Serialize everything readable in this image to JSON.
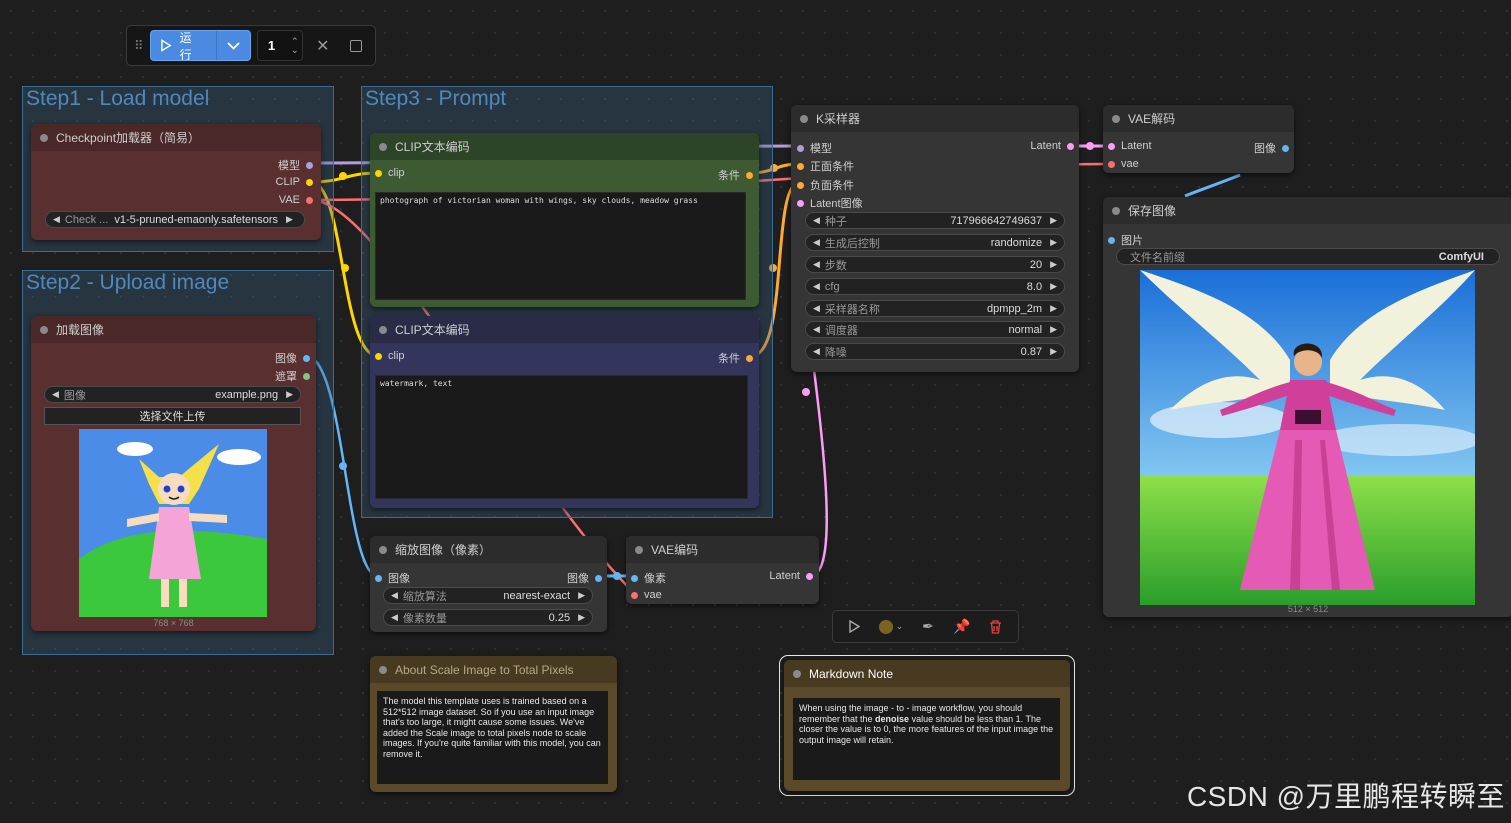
{
  "toolbar": {
    "grip_icon": "drag-handle-icon",
    "run_label": "运行",
    "batch_count": "1",
    "accent": "#4a8ae0"
  },
  "groups": {
    "step1": "Step1 - Load model",
    "step2": "Step2 - Upload image",
    "step3": "Step3 - Prompt"
  },
  "checkpoint": {
    "title": "Checkpoint加载器（简易）",
    "out_model": "模型",
    "out_clip": "CLIP",
    "out_vae": "VAE",
    "ckpt_label": "Check ...",
    "ckpt_value": "v1-5-pruned-emaonly.safetensors"
  },
  "load_image": {
    "title": "加载图像",
    "out_image": "图像",
    "out_mask": "遮罩",
    "image_label": "图像",
    "image_value": "example.png",
    "upload_label": "选择文件上传",
    "size_caption": "768 × 768"
  },
  "clip_pos": {
    "title": "CLIP文本编码",
    "in_clip": "clip",
    "out_cond": "条件",
    "text": "photograph of victorian woman with wings, sky clouds, meadow grass"
  },
  "clip_neg": {
    "title": "CLIP文本编码",
    "in_clip": "clip",
    "out_cond": "条件",
    "text": "watermark, text"
  },
  "ksampler": {
    "title": "K采样器",
    "in_model": "模型",
    "in_pos": "正面条件",
    "in_neg": "负面条件",
    "in_latent": "Latent图像",
    "out_latent": "Latent",
    "widgets": [
      {
        "label": "种子",
        "value": "717966642749637"
      },
      {
        "label": "生成后控制",
        "value": "randomize"
      },
      {
        "label": "步数",
        "value": "20"
      },
      {
        "label": "cfg",
        "value": "8.0"
      },
      {
        "label": "采样器名称",
        "value": "dpmpp_2m"
      },
      {
        "label": "调度器",
        "value": "normal"
      },
      {
        "label": "降噪",
        "value": "0.87"
      }
    ]
  },
  "vae_decode": {
    "title": "VAE解码",
    "in_latent": "Latent",
    "in_vae": "vae",
    "out_image": "图像"
  },
  "save_image": {
    "title": "保存图像",
    "in_images": "图片",
    "prefix_label": "文件名前缀",
    "prefix_value": "ComfyUI",
    "size_caption": "512 × 512"
  },
  "scale_image": {
    "title": "缩放图像（像素）",
    "in_image": "图像",
    "out_image": "图像",
    "method_label": "缩放算法",
    "method_value": "nearest-exact",
    "mp_label": "像素数量",
    "mp_value": "0.25"
  },
  "vae_encode": {
    "title": "VAE编码",
    "in_pixels": "像素",
    "in_vae": "vae",
    "out_latent": "Latent"
  },
  "note_scale": {
    "title": "About Scale Image to Total Pixels",
    "text": "The model this template uses is trained based on a 512*512 image dataset. So if you use an input image that's too large, it might cause some issues. We've added the Scale image to total pixels node to scale images. If you're quite familiar with this model, you can remove it."
  },
  "note_markdown": {
    "title": "Markdown Note",
    "text_a": "When using the image - to - image workflow, you should remember that the ",
    "text_bold": "denoise",
    "text_b": " value should be less than 1. The closer the value is to 0, the more features of the input image the output image will retain."
  },
  "watermark": "CSDN @万里鹏程转瞬至",
  "colors": {
    "model": "#b39ddb",
    "clip": "#ffd500",
    "vae": "#ff6e6e",
    "conditioning": "#ffa931",
    "latent": "#ff9cf9",
    "image": "#64b5f6",
    "mask": "#81c784"
  }
}
